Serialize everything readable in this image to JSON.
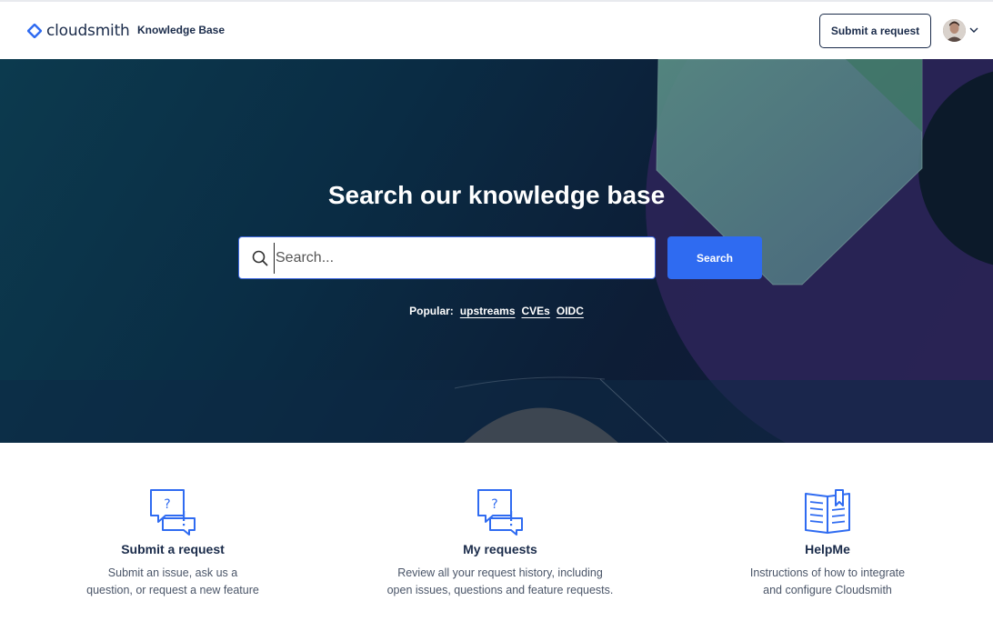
{
  "header": {
    "brand": "cloudsmith",
    "nav_link": "Knowledge Base",
    "submit_button": "Submit a request"
  },
  "hero": {
    "title": "Search our knowledge base",
    "search": {
      "placeholder": "Search...",
      "value": "",
      "button": "Search"
    },
    "popular": {
      "label": "Popular:",
      "links": [
        "upstreams",
        "CVEs",
        "OIDC"
      ]
    }
  },
  "cards": [
    {
      "title": "Submit a request",
      "description_line1": "Submit an issue, ask us a",
      "description_line2": "question, or request a new feature",
      "icon": "question-chat-icon"
    },
    {
      "title": "My requests",
      "description_line1": "Review all your request history, including",
      "description_line2": "open issues, questions and feature requests.",
      "icon": "question-chat-icon"
    },
    {
      "title": "HelpMe",
      "description_line1": "Instructions of how to integrate",
      "description_line2": "and configure Cloudsmith",
      "icon": "open-book-icon"
    }
  ],
  "colors": {
    "accent": "#2f6bf1",
    "brand": "#1a2b4a",
    "icon_blue": "#2f6bf1"
  }
}
